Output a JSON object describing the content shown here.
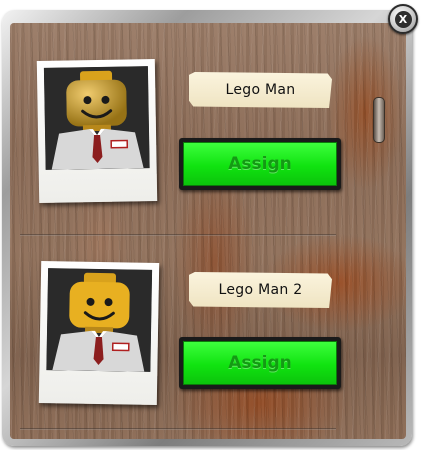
{
  "dialog": {
    "close_label": "X",
    "close_icon": "close-icon"
  },
  "entries": [
    {
      "name": "Lego Man",
      "assign_label": "Assign",
      "avatar_icon": "lego-minifigure-icon"
    },
    {
      "name": "Lego Man 2",
      "assign_label": "Assign",
      "avatar_icon": "lego-minifigure-icon"
    }
  ],
  "colors": {
    "assign_button": "#16e816",
    "assign_text": "#149a14",
    "name_tag": "#f7efd4",
    "background_rust": "#8a6a55",
    "frame": "#b0b0b0"
  }
}
